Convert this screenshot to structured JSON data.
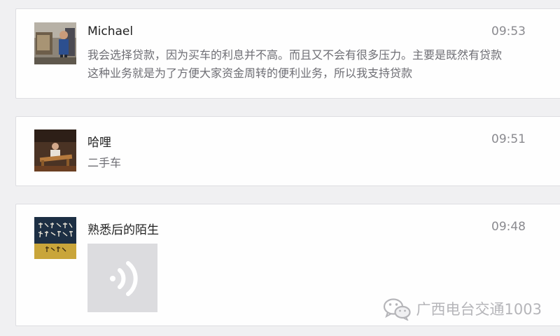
{
  "messages": [
    {
      "name": "Michael",
      "time": "09:53",
      "text": "我会选择贷款，因为买车的利息并不高。而且又不会有很多压力。主要是既然有贷款这种业务就是为了方便大家资金周转的便利业务，所以我支持贷款",
      "avatar_icon": "person-photo-avatar"
    },
    {
      "name": "哈哩",
      "time": "09:51",
      "text": "二手车",
      "avatar_icon": "instrument-photo-avatar"
    },
    {
      "name": "熟悉后的陌生",
      "time": "09:48",
      "attachment": "voice-message",
      "avatar_icon": "calligraphy-avatar",
      "avatar_text": "不求天知，人知 但求心问心无愧 自己加油"
    }
  ],
  "watermark": {
    "text": "广西电台交通1003",
    "icon": "wechat-icon"
  },
  "colors": {
    "background": "#f0f0f2",
    "card": "#fefefe",
    "name": "#222222",
    "text": "#6e6e74",
    "time": "#8a8a8f",
    "voice_bg": "#dcdcdf"
  }
}
